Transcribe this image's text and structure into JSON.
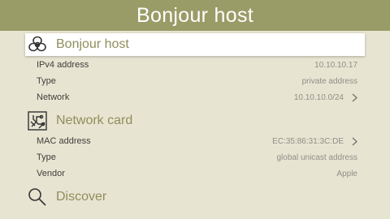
{
  "app": {
    "title": "Bonjour host"
  },
  "sections": {
    "bonjour": {
      "title": "Bonjour host",
      "rows": [
        {
          "label": "IPv4 address",
          "value": "10.10.10.17"
        },
        {
          "label": "Type",
          "value": "private address"
        },
        {
          "label": "Network",
          "value": "10.10.10.0/24"
        }
      ]
    },
    "network_card": {
      "title": "Network card",
      "rows": [
        {
          "label": "MAC address",
          "value": "EC:35:86:31:3C:DE"
        },
        {
          "label": "Type",
          "value": "global unicast address"
        },
        {
          "label": "Vendor",
          "value": "Apple"
        }
      ]
    },
    "discover": {
      "title": "Discover"
    }
  },
  "colors": {
    "header_bar": "#9a9c68",
    "background": "#e7e4d2",
    "accent_text": "#8e8f5a"
  },
  "icons": [
    "bonjour-icon",
    "network-card-icon",
    "search-icon",
    "chevron-right-icon"
  ]
}
